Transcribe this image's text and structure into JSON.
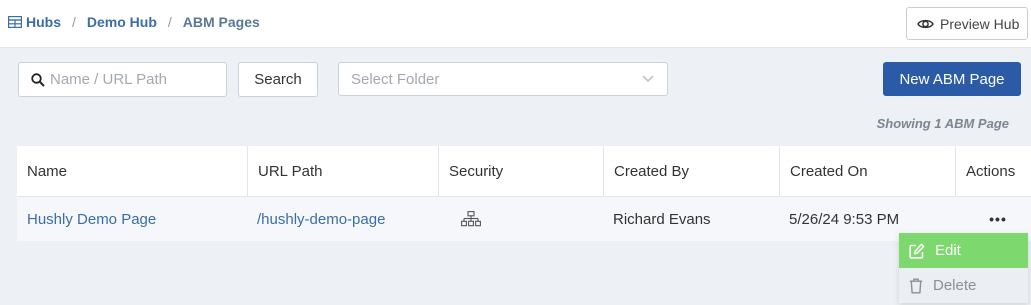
{
  "breadcrumb": {
    "items": [
      "Hubs",
      "Demo Hub",
      "ABM Pages"
    ],
    "separator": "/"
  },
  "header": {
    "preview_label": "Preview Hub"
  },
  "toolbar": {
    "search_placeholder": "Name / URL Path",
    "search_button": "Search",
    "folder_placeholder": "Select Folder",
    "new_button": "New ABM Page"
  },
  "summary": "Showing 1 ABM Page",
  "table": {
    "columns": [
      "Name",
      "URL Path",
      "Security",
      "Created By",
      "Created On",
      "Actions"
    ],
    "rows": [
      {
        "name": "Hushly Demo Page",
        "url_path": "/hushly-demo-page",
        "security_icon": "sitemap-icon",
        "created_by": "Richard Evans",
        "created_on": "5/26/24 9:53 PM",
        "actions_icon": "more-dots-icon"
      }
    ]
  },
  "actions_menu": {
    "items": [
      {
        "label": "Edit",
        "icon": "edit-icon"
      },
      {
        "label": "Delete",
        "icon": "trash-icon"
      }
    ]
  },
  "colors": {
    "primary": "#2b5aa6",
    "link": "#3a6ea5",
    "edit_highlight": "#7dd86d",
    "background": "#edf0f4"
  }
}
